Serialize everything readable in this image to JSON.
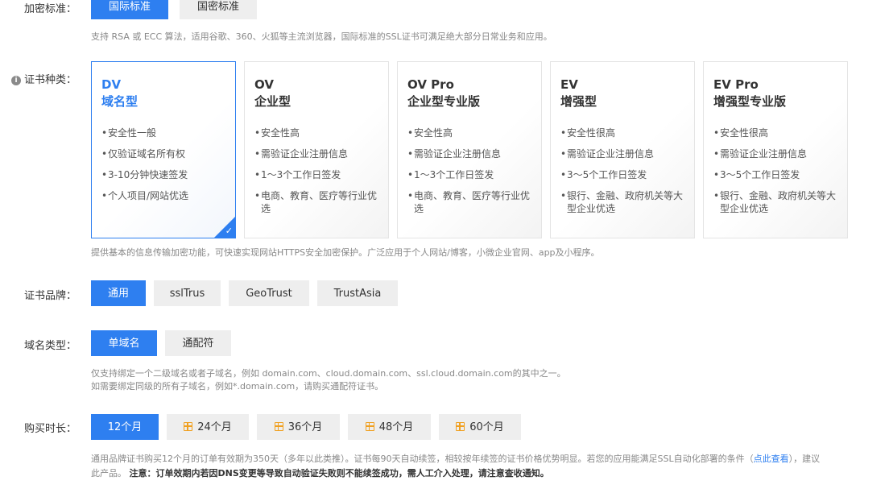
{
  "encryption": {
    "label": "加密标准：",
    "options": [
      "国际标准",
      "国密标准"
    ],
    "hint": "支持 RSA 或 ECC 算法，适用谷歌、360、火狐等主流浏览器，国际标准的SSL证书可满足绝大部分日常业务和应用。"
  },
  "cert_type": {
    "label": "证书种类：",
    "info_icon": "info-icon",
    "cards": [
      {
        "title1": "DV",
        "title2": "域名型",
        "items": [
          "安全性一般",
          "仅验证域名所有权",
          "3-10分钟快速签发",
          "个人项目/网站优选"
        ]
      },
      {
        "title1": "OV",
        "title2": "企业型",
        "items": [
          "安全性高",
          "需验证企业注册信息",
          "1～3个工作日签发",
          "电商、教育、医疗等行业优选"
        ]
      },
      {
        "title1": "OV Pro",
        "title2": "企业型专业版",
        "items": [
          "安全性高",
          "需验证企业注册信息",
          "1～3个工作日签发",
          "电商、教育、医疗等行业优选"
        ]
      },
      {
        "title1": "EV",
        "title2": "增强型",
        "items": [
          "安全性很高",
          "需验证企业注册信息",
          "3～5个工作日签发",
          "银行、金融、政府机关等大型企业优选"
        ]
      },
      {
        "title1": "EV Pro",
        "title2": "增强型专业版",
        "items": [
          "安全性很高",
          "需验证企业注册信息",
          "3～5个工作日签发",
          "银行、金融、政府机关等大型企业优选"
        ]
      }
    ],
    "check_mark": "✓",
    "hint": "提供基本的信息传输加密功能，可快速实现网站HTTPS安全加密保护。广泛应用于个人网站/博客，小微企业官网、app及小程序。"
  },
  "brand": {
    "label": "证书品牌：",
    "options": [
      "通用",
      "sslTrus",
      "GeoTrust",
      "TrustAsia"
    ]
  },
  "domain": {
    "label": "域名类型：",
    "options": [
      "单域名",
      "通配符"
    ],
    "hint1": "仅支持绑定一个二级域名或者子域名，例如 domain.com、cloud.domain.com、ssl.cloud.domain.com的其中之一。",
    "hint2": "如需要绑定同级的所有子域名，例如*.domain.com，请购买通配符证书。"
  },
  "duration": {
    "label": "购买时长：",
    "options": [
      "12个月",
      "24个月",
      "36个月",
      "48个月",
      "60个月"
    ],
    "hint_a": "通用品牌证书购买12个月的订单有效期为350天（多年以此类推）。证书每90天自动续签，相较按年续签的证书价格优势明显。若您的应用能满足SSL自动化部署的条件（",
    "hint_link": "点此查看",
    "hint_b": "），建议",
    "hint2_a": "此产品。",
    "hint2_strong": "注意：订单效期内若因DNS变更等导致自动验证失败则不能续签成功，需人工介入处理，请注意查收通知。"
  },
  "colors": {
    "accent": "#2e7ff0",
    "gift": "#f0a020"
  }
}
